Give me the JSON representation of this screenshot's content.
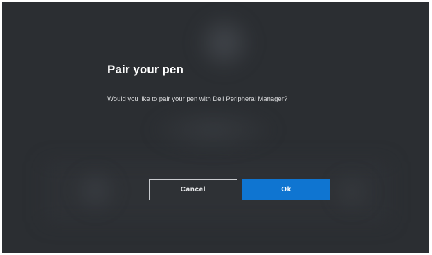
{
  "dialog": {
    "title": "Pair your pen",
    "message": "Would you like to pair your pen with Dell Peripheral Manager?",
    "cancel_label": "Cancel",
    "ok_label": "Ok"
  },
  "colors": {
    "background": "#2b2e32",
    "primary_button": "#0f75d1",
    "text": "#ffffff"
  }
}
